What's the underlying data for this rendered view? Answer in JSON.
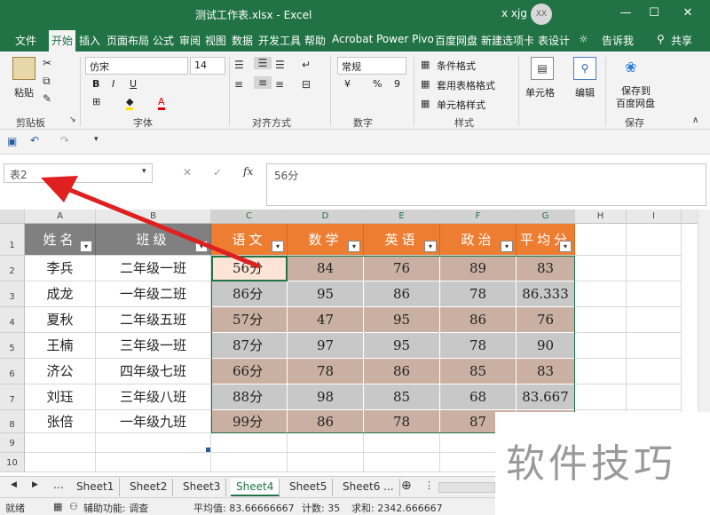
{
  "window": {
    "title": "测试工作表.xlsx  -  Excel",
    "user": "x xjg",
    "avatar": "XX",
    "min_icon": "minimize-icon",
    "max_icon": "maximize-icon",
    "close_icon": "close-icon"
  },
  "tabs": [
    "文件",
    "开始",
    "插入",
    "页面布局",
    "公式",
    "审阅",
    "视图",
    "数据",
    "开发工具",
    "帮助",
    "Acrobat",
    "Power Pivo",
    "百度网盘",
    "新建选项卡",
    "表设计"
  ],
  "active_tab": "开始",
  "tell_me": "告诉我",
  "share": "共享",
  "ribbon": {
    "paste": "粘贴",
    "font_name": "仿宋",
    "font_size": "14",
    "number_format": "常规",
    "conditional_format": "条件格式",
    "table_format": "套用表格格式",
    "cell_styles": "单元格样式",
    "cells": "单元格",
    "editing": "编辑",
    "save_baidu_1": "保存到",
    "save_baidu_2": "百度网盘",
    "groups": [
      "剪贴板",
      "字体",
      "对齐方式",
      "数字",
      "样式",
      "保存"
    ]
  },
  "name_box": "表2",
  "formula": "56分",
  "fx": "fx",
  "columns": [
    "A",
    "B",
    "C",
    "D",
    "E",
    "F",
    "G",
    "H",
    "I"
  ],
  "rows": [
    "1",
    "2",
    "3",
    "4",
    "5",
    "6",
    "7",
    "8",
    "9",
    "10"
  ],
  "table": {
    "headers": [
      "姓名",
      "班级",
      "语文",
      "数学",
      "英语",
      "政治",
      "平均分"
    ],
    "data": [
      [
        "李兵",
        "二年级一班",
        "56分",
        "84",
        "76",
        "89",
        "83"
      ],
      [
        "成龙",
        "一年级二班",
        "86分",
        "95",
        "86",
        "78",
        "86.333"
      ],
      [
        "夏秋",
        "二年级五班",
        "57分",
        "47",
        "95",
        "86",
        "76"
      ],
      [
        "王楠",
        "三年级一班",
        "87分",
        "97",
        "95",
        "78",
        "90"
      ],
      [
        "济公",
        "四年级七班",
        "66分",
        "78",
        "86",
        "85",
        "83"
      ],
      [
        "刘珏",
        "三年级八班",
        "88分",
        "98",
        "85",
        "68",
        "83.667"
      ],
      [
        "张倍",
        "一年级九班",
        "99分",
        "86",
        "78",
        "87",
        ""
      ]
    ]
  },
  "sheets": [
    "Sheet1",
    "Sheet2",
    "Sheet3",
    "Sheet4",
    "Sheet5",
    "Sheet6 ..."
  ],
  "active_sheet": "Sheet4",
  "status": {
    "ready": "就绪",
    "accessibility": "辅助功能: 调查",
    "average": "平均值: 83.66666667",
    "count": "计数: 35",
    "sum": "求和: 2342.666667"
  },
  "watermark": "软件技巧",
  "colors": {
    "excel_green": "#217346",
    "header_orange": "#ed7d31",
    "header_gray": "#808080",
    "band_brown": "#c9b0a2",
    "band_gray": "#c8c8c8",
    "active_cell": "#fde4d6",
    "arrow_red": "#e02020"
  }
}
